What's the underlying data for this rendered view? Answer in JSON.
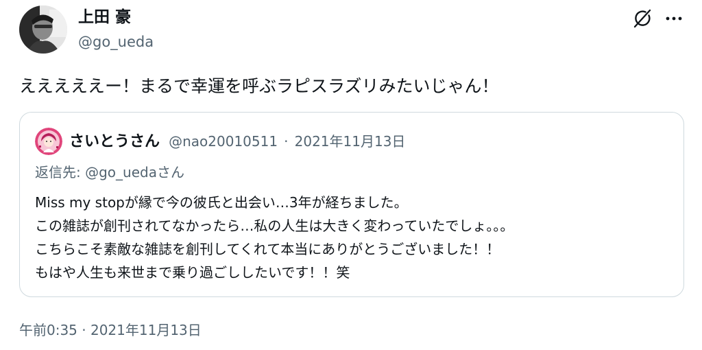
{
  "author": {
    "name": "上田 豪",
    "handle": "@go_ueda"
  },
  "icons": {
    "grok": "grok-icon",
    "more": "more-options-icon"
  },
  "tweet": {
    "text": "えええええー！まるで幸運を呼ぶラピスラズリみたいじゃん！"
  },
  "quote": {
    "name": "さいとうさん",
    "handle": "@nao20010511",
    "separator": "·",
    "date": "2021年11月13日",
    "reply_to": "返信先: @go_uedaさん",
    "lines": [
      "Miss my stopが縁で今の彼氏と出会い…3年が経ちました。",
      "この雑誌が創刊されてなかったら…私の人生は大きく変わっていたでしょ。。。",
      "こちらこそ素敵な雑誌を創刊してくれて本当にありがとうございました！！",
      "もはや人生も来世まで乗り過ごししたいです！！笑"
    ]
  },
  "footer": {
    "timestamp": "午前0:35 · 2021年11月13日"
  }
}
